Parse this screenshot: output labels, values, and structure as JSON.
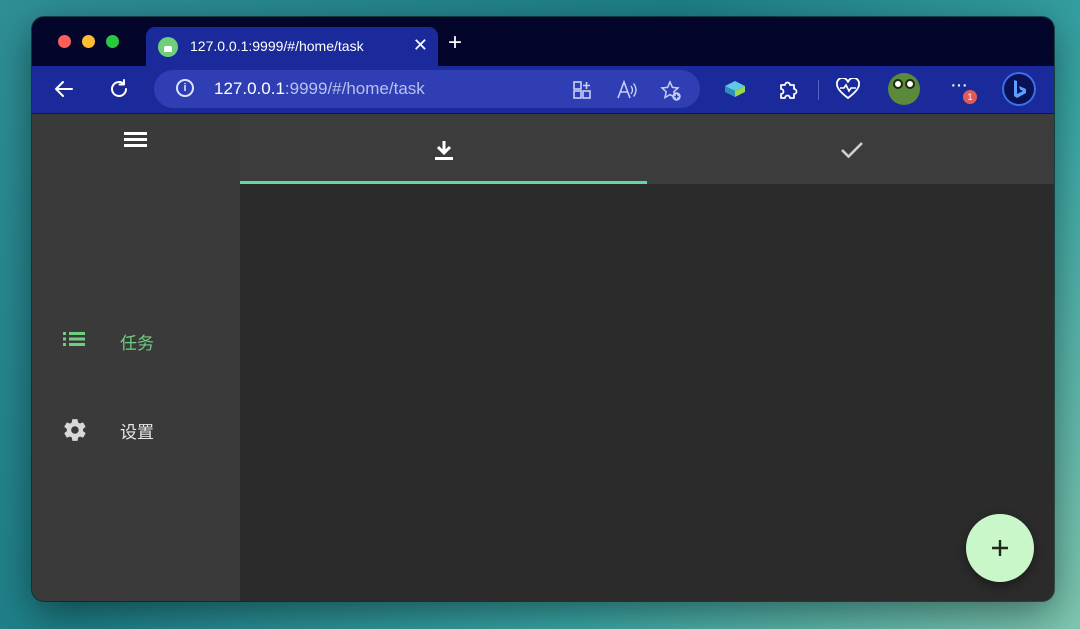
{
  "browser": {
    "tab": {
      "title": "127.0.0.1:9999/#/home/task",
      "favicon": "app-favicon"
    },
    "new_tab_label": "+",
    "url": {
      "host": "127.0.0.1",
      "rest": ":9999/#/home/task"
    },
    "more_label": "···",
    "badge_count": "1",
    "toolbar_icons": [
      "back-icon",
      "reload-icon",
      "info-icon",
      "split-screen-icon",
      "read-aloud-icon",
      "add-favorite-icon",
      "extension-icon",
      "puzzle-icon",
      "health-icon",
      "profile-avatar",
      "more-icon",
      "bing-icon"
    ]
  },
  "sidebar": {
    "menu_icon": "hamburger-icon",
    "items": [
      {
        "label": "任务",
        "icon": "list-icon",
        "active": true
      },
      {
        "label": "设置",
        "icon": "gear-icon",
        "active": false
      }
    ]
  },
  "content": {
    "tabs": [
      {
        "icon": "download-icon",
        "active": true
      },
      {
        "icon": "check-icon",
        "active": false
      }
    ]
  },
  "fab": {
    "label": "+",
    "icon": "plus-icon"
  },
  "colors": {
    "accent_green": "#6fce82",
    "tab_indicator": "#5fd9a0",
    "fab_bg": "#c9f7c9",
    "browser_toolbar": "#1a2a9a"
  }
}
